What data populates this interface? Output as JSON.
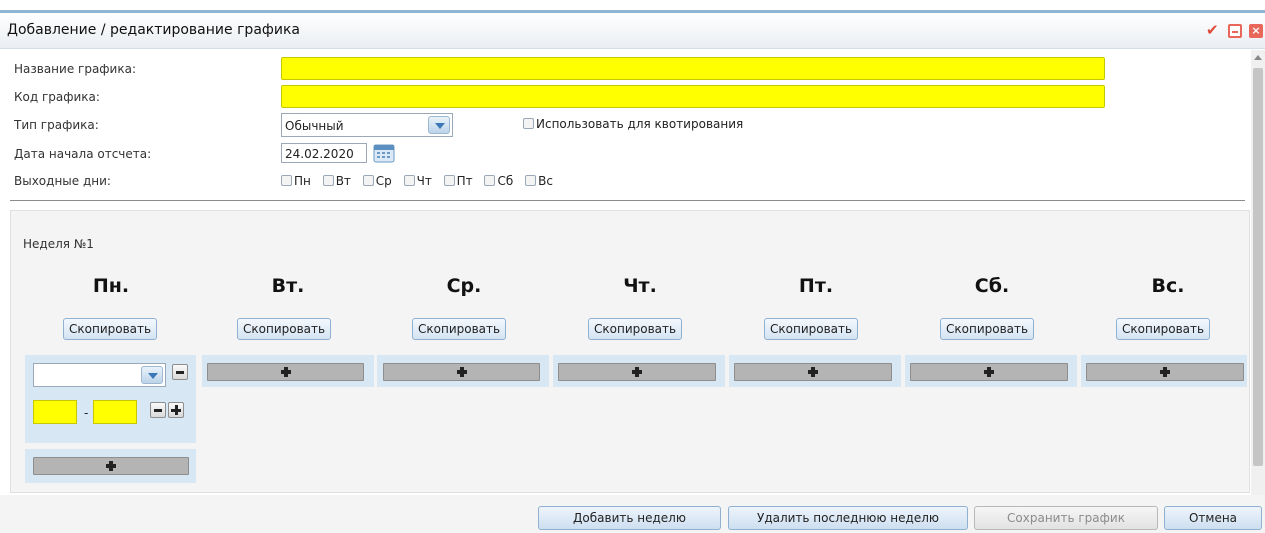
{
  "window": {
    "title": "Добавление / редактирование графика"
  },
  "form": {
    "name_label": "Название графика:",
    "name_value": "",
    "code_label": "Код графика:",
    "code_value": "",
    "type_label": "Тип графика:",
    "type_value": "Обычный",
    "quota_label": "Использовать для квотирования",
    "start_date_label": "Дата начала отсчета:",
    "start_date_value": "24.02.2020",
    "weekends_label": "Выходные дни:",
    "weekend_days": [
      "Пн",
      "Вт",
      "Ср",
      "Чт",
      "Пт",
      "Сб",
      "Вс"
    ]
  },
  "week": {
    "label": "Неделя №1",
    "days": [
      "Пн.",
      "Вт.",
      "Ср.",
      "Чт.",
      "Пт.",
      "Сб.",
      "Вс."
    ],
    "copy_label": "Скопировать",
    "time_separator": "-"
  },
  "footer": {
    "add_week": "Добавить неделю",
    "delete_last_week": "Удалить последнюю неделю",
    "save": "Сохранить график",
    "cancel": "Отмена"
  },
  "colors": {
    "required_field": "#ffff00",
    "accent": "#8fb5d3"
  },
  "icons": [
    "check-icon",
    "minimize-icon",
    "close-icon",
    "calendar-icon",
    "chevron-down-icon",
    "plus-icon",
    "minus-icon"
  ]
}
